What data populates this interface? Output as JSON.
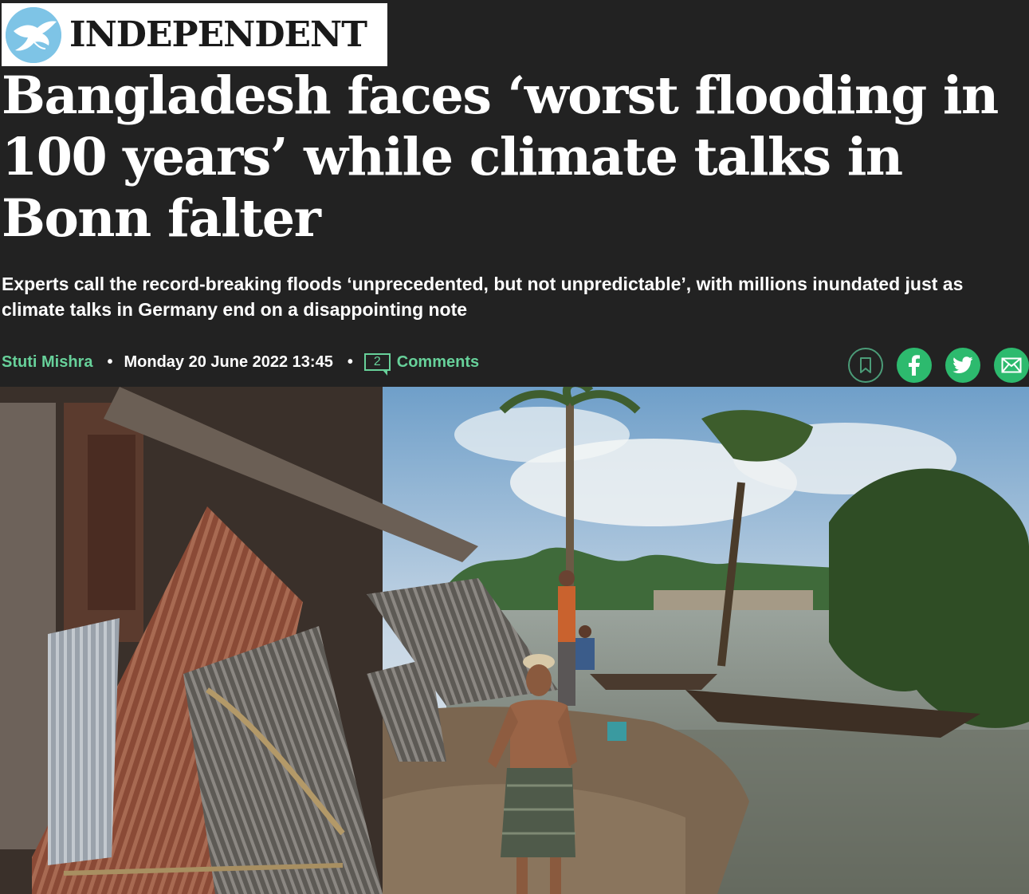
{
  "logo": {
    "text": "INDEPENDENT",
    "icon": "eagle-icon"
  },
  "article": {
    "headline": "Bangladesh faces ‘worst flooding in 100 years’ while climate talks in Bonn falter",
    "standfirst": "Experts call the record-breaking floods ‘unprecedented, but not unpredictable’, with millions inundated just as climate talks in Germany end on a disappointing note",
    "author": "Stuti Mishra",
    "separator": "•",
    "date": "Monday 20 June 2022 13:45",
    "comment_count": "2",
    "comments_label": "Comments"
  },
  "share": {
    "icons": [
      "bookmark-icon",
      "facebook-icon",
      "twitter-icon",
      "email-icon"
    ]
  },
  "colors": {
    "background": "#222222",
    "accent": "#67d19a",
    "share_green": "#2dba6e",
    "text": "#ffffff"
  },
  "hero_image": {
    "subject": "flood-damaged-houses-photo"
  }
}
